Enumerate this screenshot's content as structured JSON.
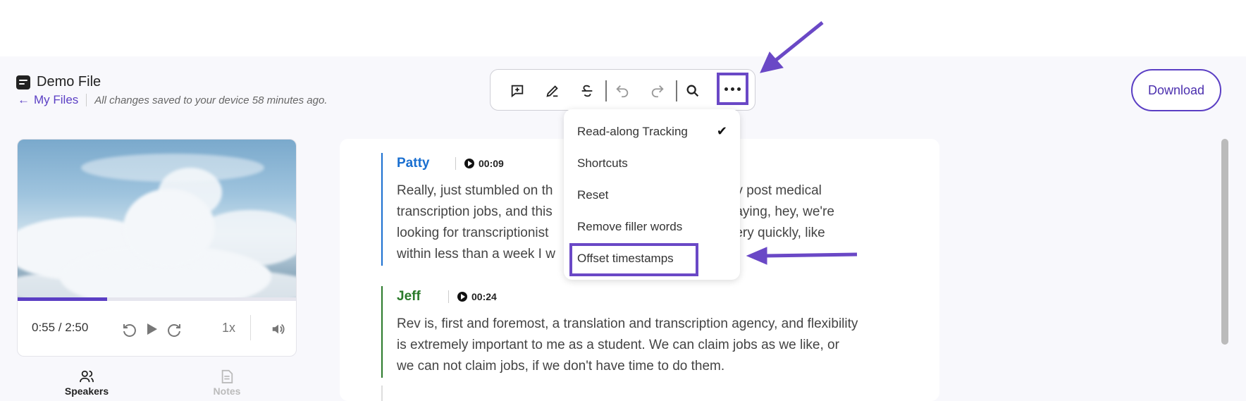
{
  "file": {
    "title": "Demo File",
    "back_label": "My Files",
    "saved_status": "All changes saved to your device 58 minutes ago."
  },
  "toolbar": {
    "buttons": [
      "add-comment-icon",
      "edit-pen-icon",
      "strikethrough-icon",
      "undo-icon",
      "redo-icon",
      "search-icon",
      "more-options-icon"
    ]
  },
  "download_label": "Download",
  "player": {
    "time": "0:55 / 2:50",
    "speed": "1x",
    "progress_fraction": 0.32
  },
  "tabs": {
    "speakers": "Speakers",
    "notes": "Notes"
  },
  "transcript": [
    {
      "speaker": "Patty",
      "timestamp": "00:09",
      "color": "#1a6fd0",
      "lines": [
        "Really, just stumbled on th",
        "transcription jobs, and this",
        "looking for transcriptionist",
        "within less than a week I w"
      ],
      "lines_right": [
        "they post medical",
        "e saying, hey, we're",
        "d very quickly, like",
        ""
      ]
    },
    {
      "speaker": "Jeff",
      "timestamp": "00:24",
      "color": "#2a7a2a",
      "lines": [
        "Rev is, first and foremost, a translation and transcription agency, and flexibility",
        "is extremely important to me as a student. We can claim jobs as we like, or",
        "we can not claim jobs, if we don't have time to do them."
      ]
    }
  ],
  "menu": {
    "items": [
      "Read-along Tracking",
      "Shortcuts",
      "Reset",
      "Remove filler words",
      "Offset timestamps"
    ],
    "checked": "Read-along Tracking"
  },
  "colors": {
    "accent": "#5b3fc4",
    "highlight": "#6a48c6"
  }
}
